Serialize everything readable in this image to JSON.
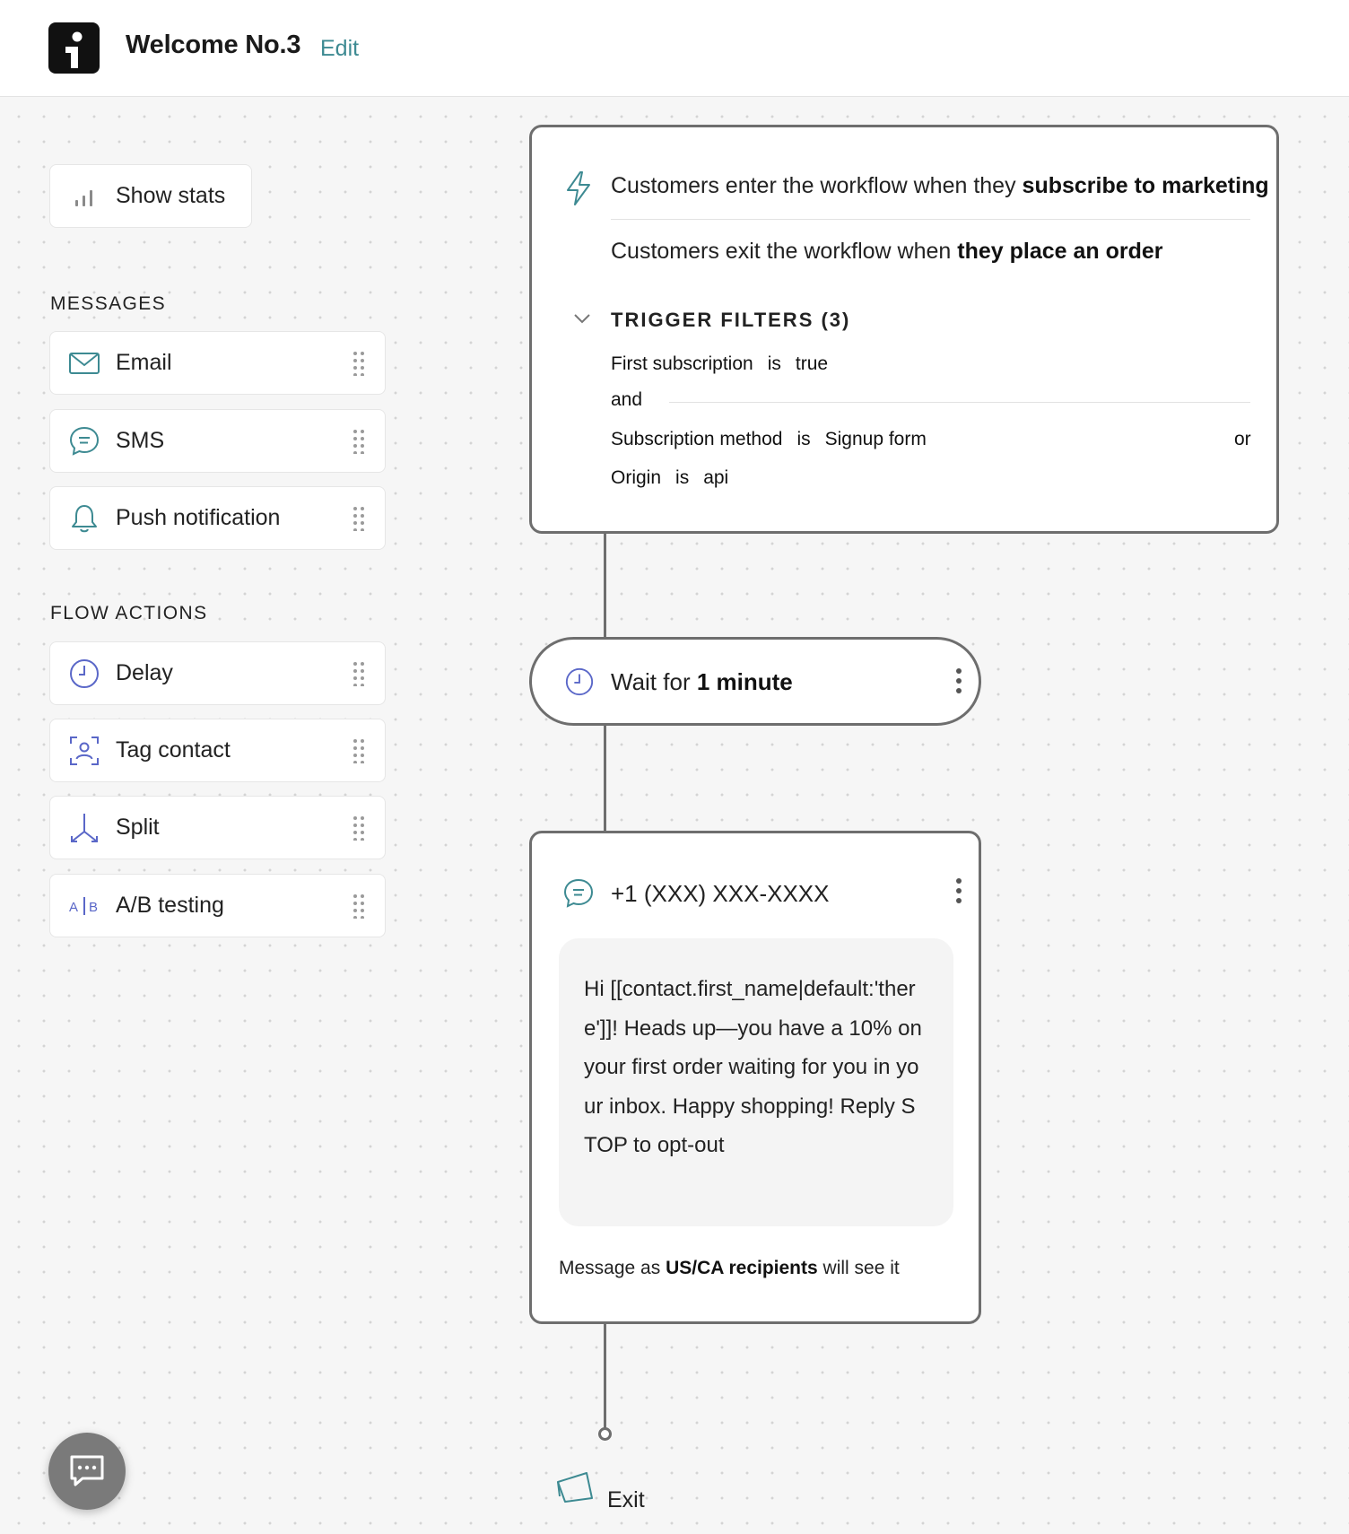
{
  "header": {
    "title": "Welcome No.3",
    "edit_label": "Edit"
  },
  "sidebar": {
    "show_stats_label": "Show stats",
    "messages_title": "MESSAGES",
    "messages": [
      {
        "label": "Email",
        "icon": "envelope-icon"
      },
      {
        "label": "SMS",
        "icon": "chat-bubble-icon"
      },
      {
        "label": "Push notification",
        "icon": "bell-icon"
      }
    ],
    "flow_actions_title": "FLOW ACTIONS",
    "flow_actions": [
      {
        "label": "Delay",
        "icon": "clock-icon"
      },
      {
        "label": "Tag contact",
        "icon": "tag-contact-icon"
      },
      {
        "label": "Split",
        "icon": "split-icon"
      },
      {
        "label": "A/B testing",
        "icon": "ab-test-icon"
      }
    ]
  },
  "trigger": {
    "enter_prefix": "Customers enter the workflow when they",
    "enter_bold": "subscribe to marketing",
    "exit_prefix": "Customers exit the workflow when",
    "exit_bold": "they place an order",
    "filters_title": "TRIGGER FILTERS (3)",
    "filters": [
      {
        "field": "First subscription",
        "op": "is",
        "value": "true"
      },
      {
        "field": "Subscription method",
        "op": "is",
        "value": "Signup form"
      },
      {
        "field": "Origin",
        "op": "is",
        "value": "api"
      }
    ],
    "and_label": "and",
    "or_label": "or"
  },
  "wait": {
    "prefix": "Wait for",
    "duration": "1 minute"
  },
  "sms": {
    "phone": "+1 (XXX) XXX-XXXX",
    "body": "Hi [[contact.first_name|default:'there']]! Heads up—you have a 10% on your first order waiting for you in your inbox. Happy shopping! Reply STOP to opt-out",
    "note_prefix": "Message as",
    "note_bold": "US/CA recipients",
    "note_suffix": "will see it"
  },
  "exit": {
    "label": "Exit"
  },
  "colors": {
    "accent_teal": "#3d8a92",
    "icon_blue": "#5a67c8",
    "connector": "#6e6e6e"
  }
}
